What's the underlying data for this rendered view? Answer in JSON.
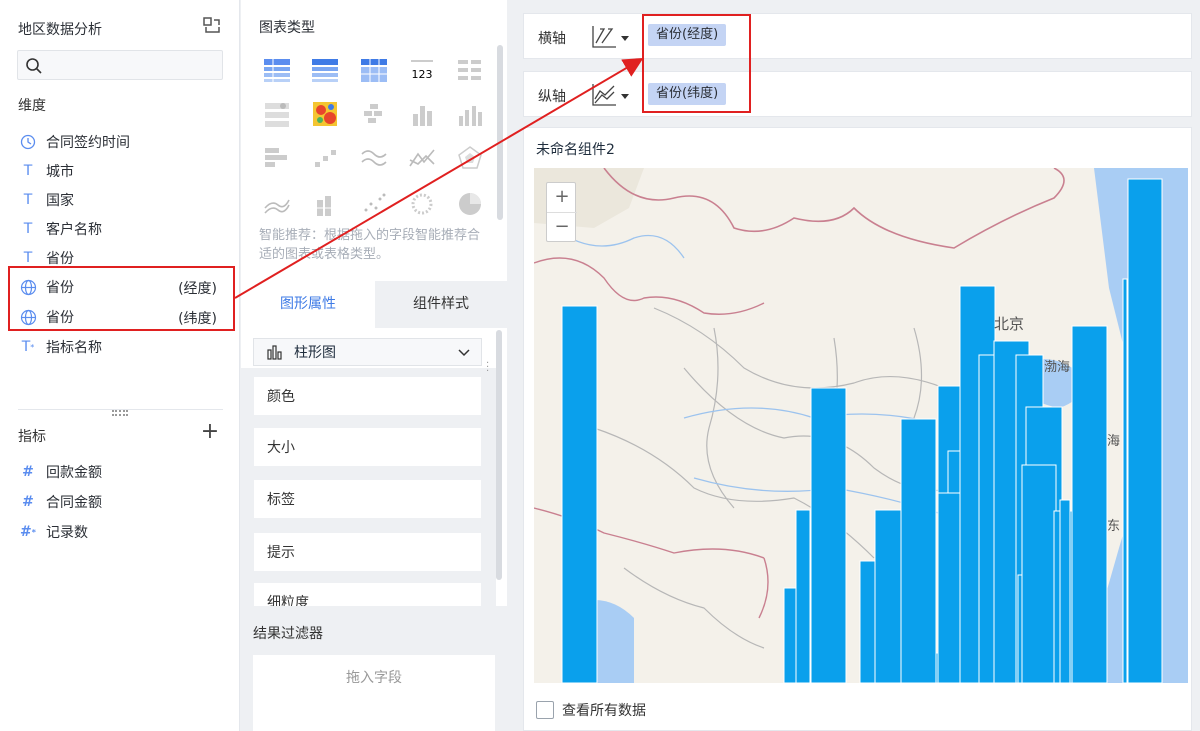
{
  "left_panel": {
    "title": "地区数据分析",
    "dimensions_title": "维度",
    "dimensions": [
      {
        "label": "合同签约时间",
        "icon": "clock-icon"
      },
      {
        "label": "城市",
        "icon": "text-type-icon"
      },
      {
        "label": "国家",
        "icon": "text-type-icon"
      },
      {
        "label": "客户名称",
        "icon": "text-type-icon"
      },
      {
        "label": "省份",
        "icon": "text-type-icon"
      },
      {
        "label": "省份",
        "suffix": "(经度)",
        "icon": "globe-icon"
      },
      {
        "label": "省份",
        "suffix": "(纬度)",
        "icon": "globe-icon"
      },
      {
        "label": "指标名称",
        "icon": "text-type-icon"
      }
    ],
    "metrics_title": "指标",
    "metrics": [
      {
        "label": "回款金额",
        "icon": "hash-icon"
      },
      {
        "label": "合同金额",
        "icon": "hash-icon"
      },
      {
        "label": "记录数",
        "icon": "hash-icon"
      }
    ]
  },
  "middle_panel": {
    "chart_types_title": "图表类型",
    "chart_type_icon_text": "123",
    "hint": "智能推荐：根据拖入的字段智能推荐合适的图表或表格类型。",
    "tabs": [
      "图形属性",
      "组件样式"
    ],
    "active_tab": "图形属性",
    "chart_type_selected": "柱形图",
    "properties": [
      "颜色",
      "大小",
      "标签",
      "提示",
      "细粒度"
    ],
    "result_filter_title": "结果过滤器",
    "drop_placeholder": "拖入字段"
  },
  "right_panel": {
    "x_axis_label": "横轴",
    "y_axis_label": "纵轴",
    "x_axis_field": "省份(经度)",
    "y_axis_field": "省份(纬度)",
    "component_title": "未命名组件2",
    "zoom_in": "+",
    "zoom_out": "−",
    "map_labels": [
      "北京",
      "渤海",
      "海",
      "东"
    ],
    "show_all_data_label": "查看所有数据"
  },
  "colors": {
    "accent": "#3f7be6",
    "bar": "#0aa0ec",
    "highlight": "#e02020",
    "pill": "#c4d4f4",
    "sea": "#a9cdf4"
  }
}
